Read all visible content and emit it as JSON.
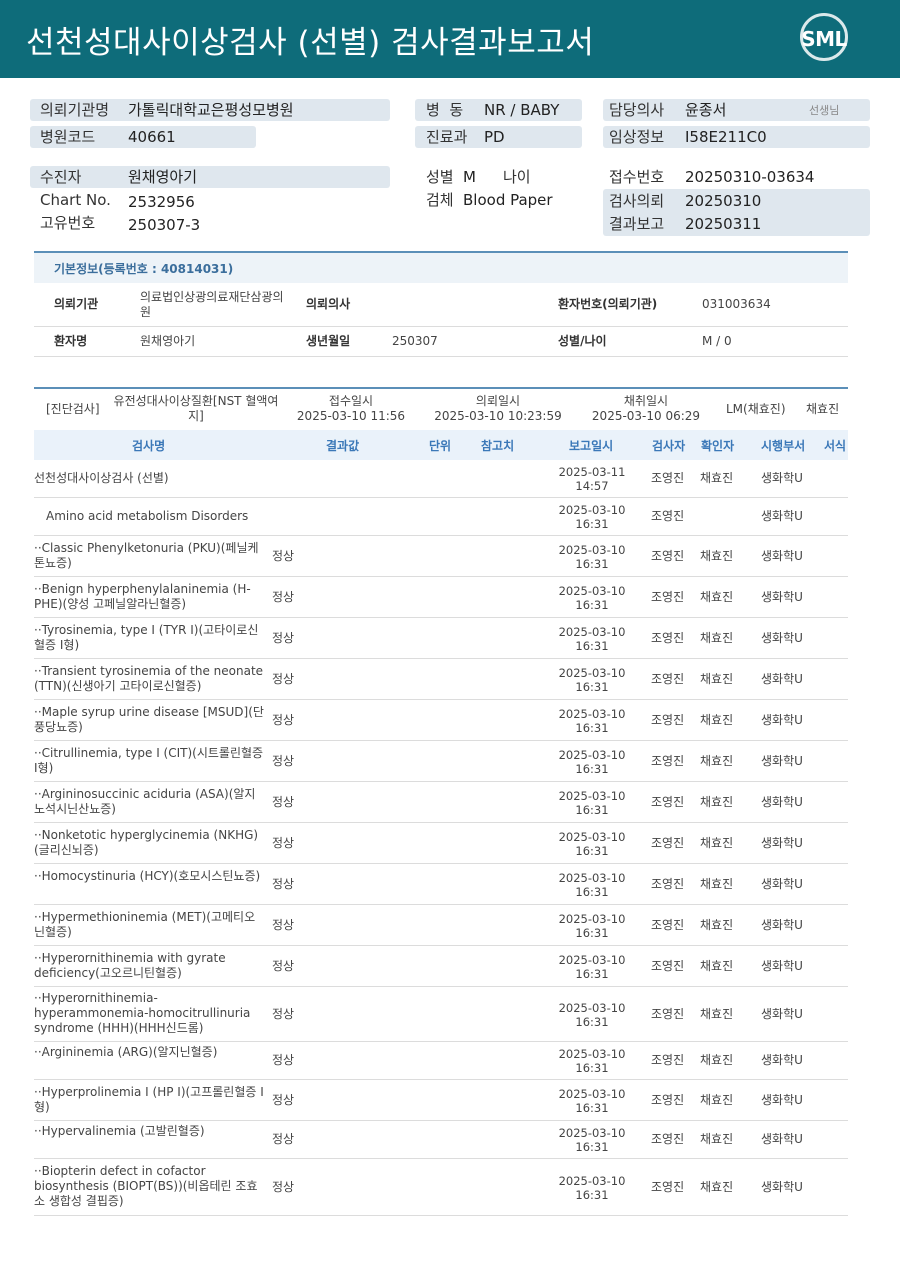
{
  "header": {
    "title": "선천성대사이상검사 (선별) 검사결과보고서",
    "logo_text": "SML"
  },
  "info": {
    "institution_label": "의뢰기관명",
    "institution_value": "가톨릭대학교은평성모병원",
    "hospital_code_label": "병원코드",
    "hospital_code_value": "40661",
    "ward_label": "병  동",
    "ward_value": "NR / BABY",
    "dept_label": "진료과",
    "dept_value": "PD",
    "doctor_label": "담당의사",
    "doctor_value": "윤종서",
    "doctor_suffix": "선생님",
    "clinical_label": "임상정보",
    "clinical_value": "I58E211C0",
    "patient_label": "수진자",
    "patient_value": "원채영아기",
    "chart_label": "Chart No.",
    "chart_value": "2532956",
    "unique_label": "고유번호",
    "unique_value": "250307-3",
    "sex_label": "성별",
    "sex_value": "M",
    "age_label": "나이",
    "age_value": "",
    "specimen_label": "검체",
    "specimen_value": "Blood Paper",
    "receipt_label": "접수번호",
    "receipt_value": "20250310-03634",
    "request_label": "검사의뢰",
    "request_value": "20250310",
    "report_label": "결과보고",
    "report_value": "20250311"
  },
  "basic": {
    "section_title": "기본정보(등록번호 : 40814031)",
    "inst_label": "의뢰기관",
    "inst_value": "의료법인상광의료재단삼광의원",
    "doctor_label": "의뢰의사",
    "doctor_value": "",
    "patient_no_label": "환자번호(의뢰기관)",
    "patient_no_value": "031003634",
    "name_label": "환자명",
    "name_value": "원채영아기",
    "birth_label": "생년월일",
    "birth_value": "250307",
    "sexage_label": "성별/나이",
    "sexage_value": "M / 0"
  },
  "order": {
    "tag": "[진단검사]",
    "test": "유전성대사이상질환[NST 혈액여지]",
    "receipt_label": "접수일시",
    "receipt_value": "2025-03-10 11:56",
    "request_label": "의뢰일시",
    "request_value": "2025-03-10 10:23:59",
    "collect_label": "채취일시",
    "collect_value": "2025-03-10 06:29",
    "lm": "LM(채효진)",
    "person": "채효진"
  },
  "table": {
    "headers": {
      "name": "검사명",
      "result": "결과값",
      "unit": "단위",
      "ref": "참고치",
      "report_date": "보고일시",
      "examiner": "검사자",
      "confirmer": "확인자",
      "dept": "시행부서",
      "format": "서식"
    },
    "rows": [
      {
        "name": "선천성대사이상검사 (선별)",
        "result": "",
        "date": "2025-03-11",
        "time": "14:57",
        "examiner": "조영진",
        "confirmer": "채효진",
        "dept": "생화학U"
      },
      {
        "name": "Amino acid metabolism Disorders",
        "result": "",
        "date": "2025-03-10",
        "time": "16:31",
        "examiner": "조영진",
        "confirmer": "",
        "dept": "생화학U"
      },
      {
        "name": "··Classic Phenylketonuria (PKU)(페닐케톤뇨증)",
        "result": "정상",
        "date": "2025-03-10",
        "time": "16:31",
        "examiner": "조영진",
        "confirmer": "채효진",
        "dept": "생화학U"
      },
      {
        "name": "··Benign hyperphenylalaninemia (H-PHE)(양성 고페닐알라닌혈증)",
        "result": "정상",
        "date": "2025-03-10",
        "time": "16:31",
        "examiner": "조영진",
        "confirmer": "채효진",
        "dept": "생화학U"
      },
      {
        "name": "··Tyrosinemia, type I (TYR I)(고타이로신혈증 I형)",
        "result": "정상",
        "date": "2025-03-10",
        "time": "16:31",
        "examiner": "조영진",
        "confirmer": "채효진",
        "dept": "생화학U"
      },
      {
        "name": "··Transient tyrosinemia of the neonate (TTN)(신생아기 고타이로신혈증)",
        "result": "정상",
        "date": "2025-03-10",
        "time": "16:31",
        "examiner": "조영진",
        "confirmer": "채효진",
        "dept": "생화학U"
      },
      {
        "name": "··Maple syrup urine disease [MSUD](단풍당뇨증)",
        "result": "정상",
        "date": "2025-03-10",
        "time": "16:31",
        "examiner": "조영진",
        "confirmer": "채효진",
        "dept": "생화학U"
      },
      {
        "name": "··Citrullinemia, type I (CIT)(시트롤린혈증 I형)",
        "result": "정상",
        "date": "2025-03-10",
        "time": "16:31",
        "examiner": "조영진",
        "confirmer": "채효진",
        "dept": "생화학U"
      },
      {
        "name": "··Argininosuccinic aciduria (ASA)(알지노석시닌산뇨증)",
        "result": "정상",
        "date": "2025-03-10",
        "time": "16:31",
        "examiner": "조영진",
        "confirmer": "채효진",
        "dept": "생화학U"
      },
      {
        "name": "··Nonketotic hyperglycinemia (NKHG)(글리신뇌증)",
        "result": "정상",
        "date": "2025-03-10",
        "time": "16:31",
        "examiner": "조영진",
        "confirmer": "채효진",
        "dept": "생화학U"
      },
      {
        "name": "··Homocystinuria (HCY)(호모시스틴뇨증)",
        "result": "정상",
        "date": "2025-03-10",
        "time": "16:31",
        "examiner": "조영진",
        "confirmer": "채효진",
        "dept": "생화학U"
      },
      {
        "name": "··Hypermethioninemia (MET)(고메티오닌혈증)",
        "result": "정상",
        "date": "2025-03-10",
        "time": "16:31",
        "examiner": "조영진",
        "confirmer": "채효진",
        "dept": "생화학U"
      },
      {
        "name": "··Hyperornithinemia with gyrate deficiency(고오르니틴혈증)",
        "result": "정상",
        "date": "2025-03-10",
        "time": "16:31",
        "examiner": "조영진",
        "confirmer": "채효진",
        "dept": "생화학U"
      },
      {
        "name": "··Hyperornithinemia-hyperammonemia-homocitrullinuria syndrome (HHH)(HHH신드롬)",
        "result": "정상",
        "date": "2025-03-10",
        "time": "16:31",
        "examiner": "조영진",
        "confirmer": "채효진",
        "dept": "생화학U"
      },
      {
        "name": "··Argininemia (ARG)(알지닌혈증)",
        "result": "정상",
        "date": "2025-03-10",
        "time": "16:31",
        "examiner": "조영진",
        "confirmer": "채효진",
        "dept": "생화학U"
      },
      {
        "name": "··Hyperprolinemia I (HP I)(고프롤린혈증 I형)",
        "result": "정상",
        "date": "2025-03-10",
        "time": "16:31",
        "examiner": "조영진",
        "confirmer": "채효진",
        "dept": "생화학U"
      },
      {
        "name": "··Hypervalinemia (고발린혈증)",
        "result": "정상",
        "date": "2025-03-10",
        "time": "16:31",
        "examiner": "조영진",
        "confirmer": "채효진",
        "dept": "생화학U"
      },
      {
        "name": "··Biopterin defect in cofactor biosynthesis (BIOPT(BS))(비옵테린 조효소 생합성 결핍증)",
        "result": "정상",
        "date": "2025-03-10",
        "time": "16:31",
        "examiner": "조영진",
        "confirmer": "채효진",
        "dept": "생화학U"
      }
    ]
  }
}
